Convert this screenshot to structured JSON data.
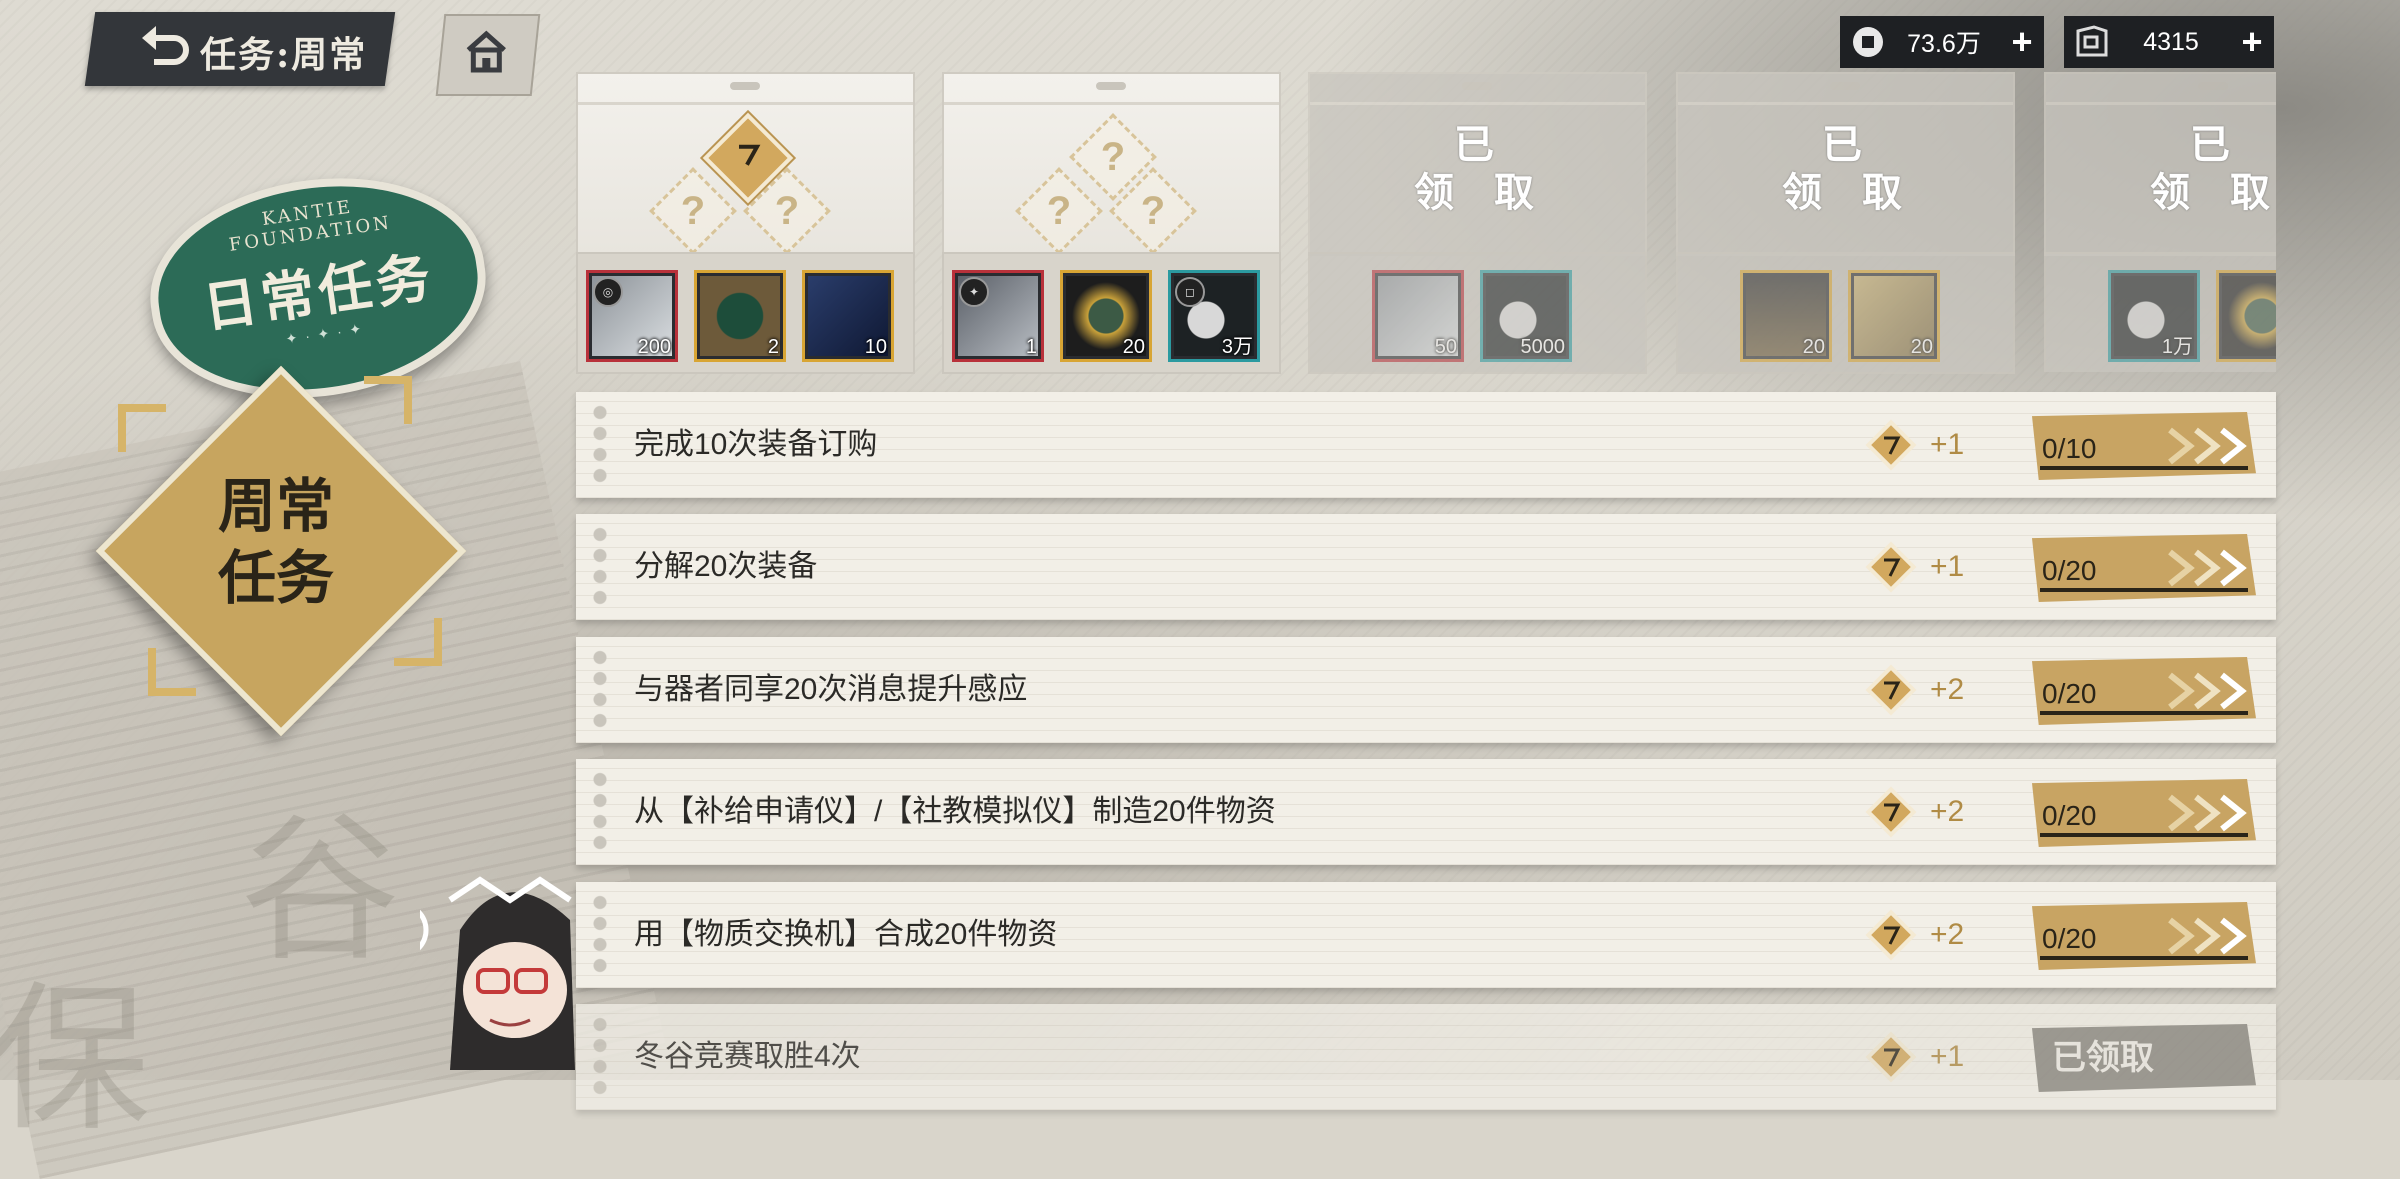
{
  "header": {
    "title": "任务:周常"
  },
  "currencies": [
    {
      "icon": "coin-icon",
      "amount": "73.6万"
    },
    {
      "icon": "ticket-icon",
      "amount": "4315"
    }
  ],
  "sidebar": {
    "daily_tab": {
      "label": "日常任务",
      "arc_text": "KANTIE FOUNDATION"
    },
    "weekly_tab": {
      "label_line1": "周常",
      "label_line2": "任务"
    }
  },
  "reward_cards": [
    {
      "status": "locked",
      "items": [
        {
          "count": "200",
          "rarity": "red"
        },
        {
          "count": "2",
          "rarity": "gold"
        },
        {
          "count": "10",
          "rarity": "gold"
        }
      ]
    },
    {
      "status": "locked",
      "items": [
        {
          "count": "1",
          "rarity": "red"
        },
        {
          "count": "20",
          "rarity": "gold"
        },
        {
          "count": "3万",
          "rarity": "teal"
        }
      ]
    },
    {
      "status": "claimed",
      "stamp": [
        "已",
        "领",
        "取"
      ],
      "items": [
        {
          "count": "50",
          "rarity": "red"
        },
        {
          "count": "5000",
          "rarity": "teal"
        }
      ]
    },
    {
      "status": "claimed",
      "stamp": [
        "已",
        "领",
        "取"
      ],
      "items": [
        {
          "count": "20",
          "rarity": "gold"
        },
        {
          "count": "20",
          "rarity": "gold"
        }
      ]
    },
    {
      "status": "claimed",
      "stamp": [
        "已",
        "领",
        "取"
      ],
      "items": [
        {
          "count": "1万",
          "rarity": "teal"
        },
        {
          "count": "",
          "rarity": "gold"
        }
      ]
    }
  ],
  "tasks": [
    {
      "name": "完成10次装备订购",
      "points": "+1",
      "progress": "0/10",
      "current": 0,
      "target": 10
    },
    {
      "name": "分解20次装备",
      "points": "+1",
      "progress": "0/20",
      "current": 0,
      "target": 20
    },
    {
      "name": "与器者同享20次消息提升感应",
      "points": "+2",
      "progress": "0/20",
      "current": 0,
      "target": 20
    },
    {
      "name": "从【补给申请仪】/【社教模拟仪】制造20件物资",
      "points": "+2",
      "progress": "0/20",
      "current": 0,
      "target": 20
    },
    {
      "name": "用【物质交换机】合成20件物资",
      "points": "+2",
      "progress": "0/20",
      "current": 0,
      "target": 20
    },
    {
      "name": "冬谷竞赛取胜4次",
      "points": "+1",
      "status_label": "已领取"
    }
  ]
}
